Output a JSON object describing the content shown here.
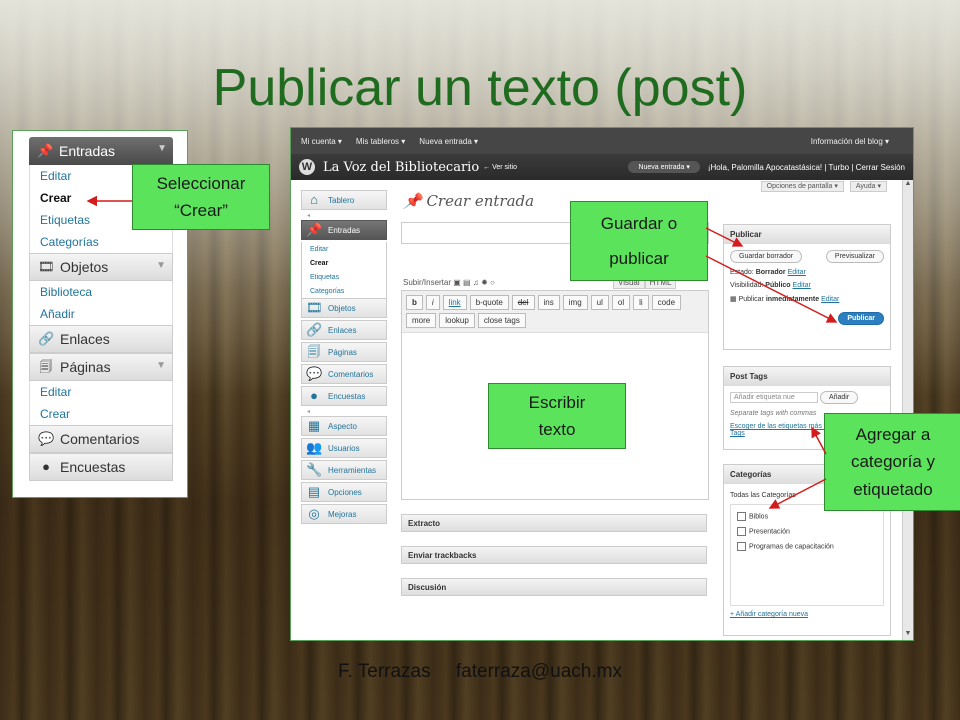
{
  "slide": {
    "title": "Publicar un texto (post)",
    "footer_name": "F. Terrazas",
    "footer_email": "faterraza@uach.mx"
  },
  "left_menu": {
    "entradas": "Entradas",
    "entradas_items": [
      "Editar",
      "Crear",
      "Etiquetas",
      "Categorías"
    ],
    "objetos": "Objetos",
    "objetos_items": [
      "Biblioteca",
      "Añadir"
    ],
    "enlaces": "Enlaces",
    "paginas": "Páginas",
    "paginas_items": [
      "Editar",
      "Crear"
    ],
    "comentarios": "Comentarios",
    "encuestas": "Encuestas"
  },
  "callouts": {
    "seleccionar_line1": "Seleccionar",
    "seleccionar_line2": "“Crear”",
    "guardar_line1": "Guardar o",
    "guardar_line2": "publicar",
    "escribir_line1": "Escribir",
    "escribir_line2": "texto",
    "agregar_line1": "Agregar a",
    "agregar_line2": "categoría y",
    "agregar_line3": "etiquetado"
  },
  "wp": {
    "adminbar": {
      "mi_cuenta": "Mi cuenta ▾",
      "mis_tableros": "Mis tableros ▾",
      "nueva_entrada": "Nueva entrada ▾",
      "info_blog": "Información del blog ▾"
    },
    "header": {
      "site_name": "La Voz del Bibliotecario",
      "ver_sitio": "← Ver sitio",
      "nueva_entrada_btn": "Nueva entrada ▾",
      "greeting": "¡Hola, Palomilla Apocatastásica! | Turbo | Cerrar Sesión"
    },
    "screen_options": "Opciones de pantalla ▾",
    "help": "Ayuda ▾",
    "menu": {
      "tablero": "Tablero",
      "entradas": "Entradas",
      "entradas_items": [
        "Editar",
        "Crear",
        "Etiquetas",
        "Categorías"
      ],
      "objetos": "Objetos",
      "enlaces": "Enlaces",
      "paginas": "Páginas",
      "comentarios": "Comentarios",
      "encuestas": "Encuestas",
      "aspecto": "Aspecto",
      "usuarios": "Usuarios",
      "herramientas": "Herramientas",
      "opciones": "Opciones",
      "mejoras": "Mejoras"
    },
    "editor": {
      "heading": "Crear entrada",
      "upload_label": "Subir/Insertar",
      "tab_visual": "Visual",
      "tab_html": "HTML",
      "quicktags": [
        "b",
        "i",
        "link",
        "b-quote",
        "del",
        "ins",
        "img",
        "ul",
        "ol",
        "li",
        "code",
        "more",
        "lookup",
        "close tags"
      ]
    },
    "postboxes": {
      "extracto": "Extracto",
      "trackbacks": "Enviar trackbacks",
      "discusion": "Discusión"
    },
    "publish": {
      "heading": "Publicar",
      "save_draft": "Guardar borrador",
      "preview": "Previsualizar",
      "status_label": "Estado:",
      "status_value": "Borrador",
      "visibility_label": "Visibilidad:",
      "visibility_value": "Público",
      "publish_label": "Publicar",
      "publish_value": "inmediatamente",
      "edit": "Editar",
      "publish_btn": "Publicar"
    },
    "tags": {
      "heading": "Post Tags",
      "placeholder": "Añadir etiqueta nue",
      "add_btn": "Añadir",
      "hint": "Separate tags with commas",
      "choose_link": "Escoger de las etiquetas más usadas en Post Tags"
    },
    "categories": {
      "heading": "Categorías",
      "all_tab": "Todas las Categorías",
      "items": [
        "Biblos",
        "Presentación",
        "Programas de capacitación"
      ],
      "add_new": "+ Añadir categoría nueva"
    }
  }
}
